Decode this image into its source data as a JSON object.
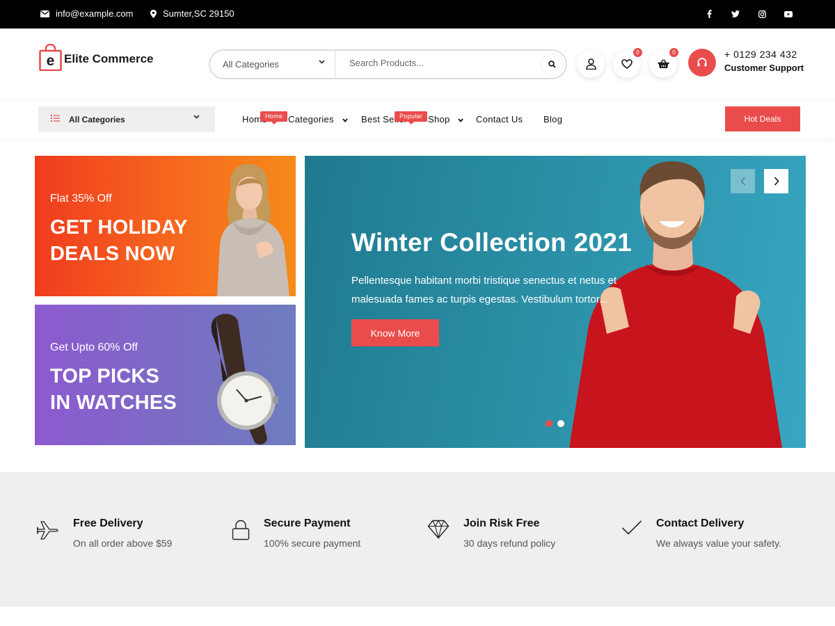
{
  "topbar": {
    "email": "info@example.com",
    "location": "Sumter,SC 29150",
    "socials": [
      "facebook-icon",
      "twitter-icon",
      "instagram-icon",
      "youtube-icon"
    ]
  },
  "header": {
    "logo_letter": "e",
    "logo_text": "Elite Commerce",
    "search": {
      "category": "All Categories",
      "placeholder": "Search Products..."
    },
    "wishlist_count": "0",
    "cart_count": "0",
    "support_phone": "+ 0129 234 432",
    "support_label": "Customer Support"
  },
  "nav": {
    "all_categories": "All Categories",
    "links": [
      {
        "label": "Home",
        "tag": "Home"
      },
      {
        "label": "Categories"
      },
      {
        "label": "Best Seller",
        "tag": "Popular"
      },
      {
        "label": "Shop"
      },
      {
        "label": "Contact Us"
      },
      {
        "label": "Blog"
      }
    ],
    "hot_deals": "Hot Deals"
  },
  "promos": [
    {
      "kicker": "Flat 35% Off",
      "line1": "GET HOLIDAY",
      "line2": "DEALS NOW"
    },
    {
      "kicker": "Get Upto 60% Off",
      "line1": "TOP PICKS",
      "line2": "IN WATCHES"
    }
  ],
  "hero": {
    "title": "Winter Collection 2021",
    "description_line1": "Pellentesque habitant morbi tristique senectus et netus et",
    "description_line2": "malesuada fames ac turpis egestas. Vestibulum tortor...",
    "cta": "Know More",
    "active_slide": 1,
    "slide_count": 2
  },
  "features": [
    {
      "icon": "airplane-icon",
      "title": "Free Delivery",
      "subtitle": "On all order above $59"
    },
    {
      "icon": "lock-icon",
      "title": "Secure Payment",
      "subtitle": "100% secure payment"
    },
    {
      "icon": "diamond-icon",
      "title": "Join Risk Free",
      "subtitle": "30 days refund policy"
    },
    {
      "icon": "checkmark-icon",
      "title": "Contact Delivery",
      "subtitle": "We always value your safety."
    }
  ],
  "colors": {
    "accent": "#ea4c4c",
    "topbar": "#000000",
    "promo_orange": "#f5651e",
    "promo_purple": "#7a6cc4",
    "hero_teal": "#2a8ea5"
  }
}
